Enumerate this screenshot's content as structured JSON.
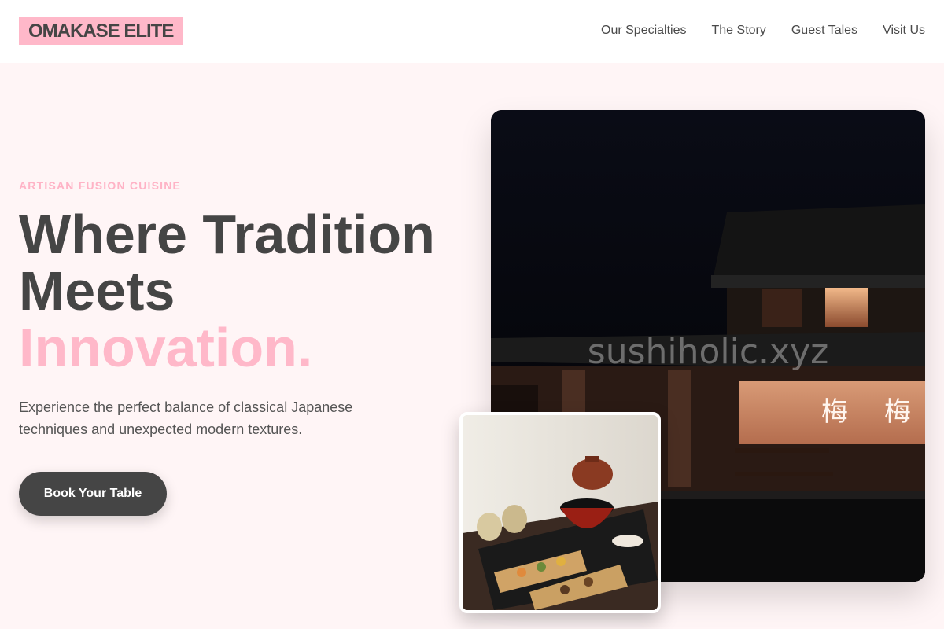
{
  "brand": {
    "logo": "OMAKASE ELITE"
  },
  "nav": {
    "items": [
      {
        "label": "Our Specialties"
      },
      {
        "label": "The Story"
      },
      {
        "label": "Guest Tales"
      },
      {
        "label": "Visit Us"
      }
    ]
  },
  "hero": {
    "eyebrow": "ARTISAN FUSION CUISINE",
    "headline_line1": "Where Tradition",
    "headline_line2": "Meets",
    "headline_accent": "Innovation.",
    "subtitle": "Experience the perfect balance of classical Japanese techniques and unexpected modern textures.",
    "cta_label": "Book Your Table"
  },
  "images": {
    "watermark": "sushiholic.xyz"
  },
  "colors": {
    "accent": "#ffb8c9",
    "dark": "#454545",
    "background": "#fff5f6"
  }
}
